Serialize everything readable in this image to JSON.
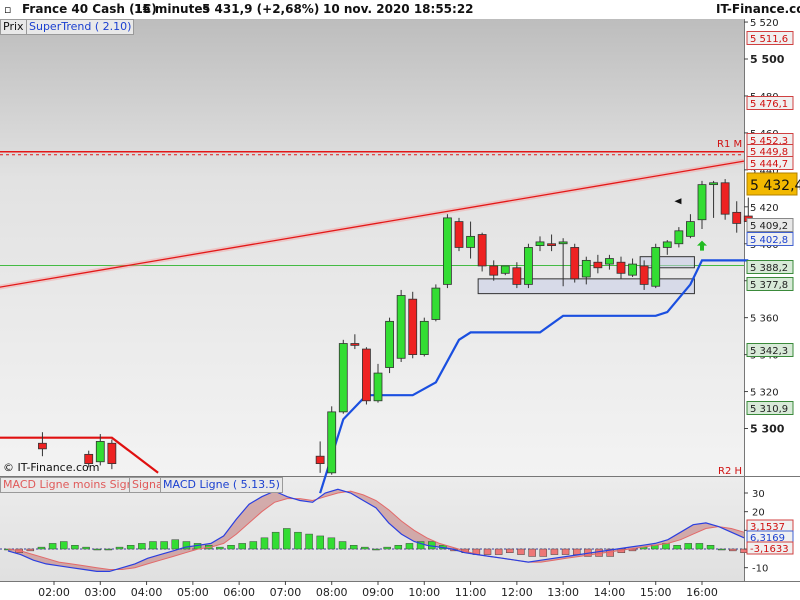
{
  "header": {
    "instrument": "France 40 Cash (1€)",
    "timeframe": "15 minutes",
    "last_change": "5 431,9 (+2,68%)",
    "datetime": "10 nov. 2020 18:55:22",
    "brand": "IT-Finance.com"
  },
  "indicators": {
    "prix": "Prix",
    "supertrend": "SuperTrend ( 2.10)"
  },
  "macd_legend": {
    "histogram": "MACD Ligne moins Signal",
    "signal": "Signal",
    "line": "MACD Ligne ( 5.13.5)"
  },
  "watermark": "© IT-Finance.com",
  "level_labels": {
    "r1m": "R1 M",
    "r2h": "R2 H"
  },
  "price_axis": {
    "ticks": [
      "5 520",
      "5 500",
      "5 480",
      "5 460",
      "5 440",
      "5 420",
      "5 400",
      "5 380",
      "5 360",
      "5 340",
      "5 320",
      "5 300"
    ],
    "major": [
      "5 500",
      "5 300"
    ]
  },
  "price_tags": [
    {
      "label": "5 511,6",
      "kind": "red"
    },
    {
      "label": "5 476,1",
      "kind": "red"
    },
    {
      "label": "5 452,3",
      "kind": "red"
    },
    {
      "label": "5 449,8",
      "kind": "red"
    },
    {
      "label": "5 444,7",
      "kind": "red"
    },
    {
      "label": "5 432,4",
      "kind": "last"
    },
    {
      "label": "5 409,2",
      "kind": "grey"
    },
    {
      "label": "5 402,8",
      "kind": "blue"
    },
    {
      "label": "5 388,2",
      "kind": "green"
    },
    {
      "label": "5 377,8",
      "kind": "green"
    },
    {
      "label": "5 342,3",
      "kind": "green"
    },
    {
      "label": "5 310,9",
      "kind": "green"
    }
  ],
  "macd_axis": {
    "ticks": [
      "30",
      "20",
      "10",
      "0",
      "-10"
    ]
  },
  "macd_tags": [
    {
      "label": "3,1537",
      "kind": "red"
    },
    {
      "label": "6,3169",
      "kind": "blue"
    },
    {
      "label": "-3,1633",
      "kind": "red"
    }
  ],
  "time_axis": {
    "ticks": [
      "02:00",
      "03:00",
      "04:00",
      "05:00",
      "06:00",
      "07:00",
      "08:00",
      "09:00",
      "10:00",
      "11:00",
      "12:00",
      "13:00",
      "14:00",
      "15:00",
      "16:00"
    ]
  },
  "colors": {
    "up": "#33dd33",
    "down": "#ee2222",
    "supertrend_up": "#1a4fe0",
    "supertrend_down": "#e01010",
    "trendline": "#e31818",
    "support_line": "#44bb44",
    "resistance": "#e31818",
    "macd_line": "#2a3fe0",
    "signal_line": "#e36a6a"
  },
  "chart_data": {
    "type": "candlestick",
    "title": "France 40 Cash (1€)",
    "timeframe": "15 minutes",
    "ylim": [
      5290,
      5523
    ],
    "candles": [
      {
        "t": "01:45",
        "o": 5292,
        "h": 5298,
        "l": 5285,
        "c": 5289
      },
      {
        "t": "02:45",
        "o": 5286,
        "h": 5288,
        "l": 5279,
        "c": 5281
      },
      {
        "t": "03:00",
        "o": 5282,
        "h": 5297,
        "l": 5280,
        "c": 5293
      },
      {
        "t": "03:15",
        "o": 5292,
        "h": 5294,
        "l": 5278,
        "c": 5281
      },
      {
        "t": "07:45",
        "o": 5285,
        "h": 5293,
        "l": 5276,
        "c": 5281
      },
      {
        "t": "08:00",
        "o": 5276,
        "h": 5312,
        "l": 5275,
        "c": 5309
      },
      {
        "t": "08:15",
        "o": 5309,
        "h": 5348,
        "l": 5308,
        "c": 5346
      },
      {
        "t": "08:30",
        "o": 5346,
        "h": 5351,
        "l": 5343,
        "c": 5345
      },
      {
        "t": "08:45",
        "o": 5343,
        "h": 5344,
        "l": 5313,
        "c": 5315
      },
      {
        "t": "09:00",
        "o": 5315,
        "h": 5335,
        "l": 5314,
        "c": 5330
      },
      {
        "t": "09:15",
        "o": 5333,
        "h": 5360,
        "l": 5330,
        "c": 5358
      },
      {
        "t": "09:30",
        "o": 5338,
        "h": 5375,
        "l": 5336,
        "c": 5372
      },
      {
        "t": "09:45",
        "o": 5370,
        "h": 5374,
        "l": 5338,
        "c": 5340
      },
      {
        "t": "10:00",
        "o": 5340,
        "h": 5360,
        "l": 5339,
        "c": 5358
      },
      {
        "t": "10:15",
        "o": 5359,
        "h": 5378,
        "l": 5358,
        "c": 5376
      },
      {
        "t": "10:30",
        "o": 5378,
        "h": 5416,
        "l": 5376,
        "c": 5414
      },
      {
        "t": "10:45",
        "o": 5412,
        "h": 5414,
        "l": 5396,
        "c": 5398
      },
      {
        "t": "11:00",
        "o": 5398,
        "h": 5412,
        "l": 5392,
        "c": 5404
      },
      {
        "t": "11:15",
        "o": 5405,
        "h": 5406,
        "l": 5385,
        "c": 5388
      },
      {
        "t": "11:30",
        "o": 5388,
        "h": 5391,
        "l": 5380,
        "c": 5383
      },
      {
        "t": "11:45",
        "o": 5384,
        "h": 5388,
        "l": 5383,
        "c": 5388
      },
      {
        "t": "12:00",
        "o": 5387,
        "h": 5390,
        "l": 5376,
        "c": 5378
      },
      {
        "t": "12:15",
        "o": 5378,
        "h": 5400,
        "l": 5376,
        "c": 5398
      },
      {
        "t": "12:30",
        "o": 5399,
        "h": 5404,
        "l": 5396,
        "c": 5401
      },
      {
        "t": "12:45",
        "o": 5400,
        "h": 5405,
        "l": 5396,
        "c": 5399
      },
      {
        "t": "13:00",
        "o": 5400,
        "h": 5403,
        "l": 5377,
        "c": 5401
      },
      {
        "t": "13:15",
        "o": 5398,
        "h": 5400,
        "l": 5379,
        "c": 5381
      },
      {
        "t": "13:30",
        "o": 5382,
        "h": 5393,
        "l": 5378,
        "c": 5391
      },
      {
        "t": "13:45",
        "o": 5390,
        "h": 5394,
        "l": 5384,
        "c": 5387
      },
      {
        "t": "14:00",
        "o": 5389,
        "h": 5394,
        "l": 5386,
        "c": 5392
      },
      {
        "t": "14:15",
        "o": 5390,
        "h": 5393,
        "l": 5381,
        "c": 5384
      },
      {
        "t": "14:30",
        "o": 5383,
        "h": 5392,
        "l": 5382,
        "c": 5389
      },
      {
        "t": "14:45",
        "o": 5388,
        "h": 5391,
        "l": 5375,
        "c": 5378
      },
      {
        "t": "15:00",
        "o": 5377,
        "h": 5400,
        "l": 5376,
        "c": 5398
      },
      {
        "t": "15:15",
        "o": 5398,
        "h": 5402,
        "l": 5394,
        "c": 5401
      },
      {
        "t": "15:30",
        "o": 5400,
        "h": 5409,
        "l": 5398,
        "c": 5407
      },
      {
        "t": "15:45",
        "o": 5404,
        "h": 5416,
        "l": 5403,
        "c": 5412
      },
      {
        "t": "16:00",
        "o": 5413,
        "h": 5434,
        "l": 5408,
        "c": 5432
      },
      {
        "t": "16:15",
        "o": 5432,
        "h": 5434,
        "l": 5414,
        "c": 5433
      },
      {
        "t": "16:30",
        "o": 5433,
        "h": 5435,
        "l": 5413,
        "c": 5416
      },
      {
        "t": "16:45",
        "o": 5417,
        "h": 5423,
        "l": 5406,
        "c": 5411
      },
      {
        "t": "17:00",
        "o": 5415,
        "h": 5425,
        "l": 5411,
        "c": 5412
      }
    ],
    "supertrend": {
      "down_segment": [
        [
          "00:00",
          5319
        ],
        [
          "00:15",
          5319
        ],
        [
          "00:45",
          5295
        ],
        [
          "03:15",
          5295
        ],
        [
          "04:15",
          5276
        ]
      ],
      "up_segment": [
        [
          "07:45",
          5265
        ],
        [
          "08:15",
          5305
        ],
        [
          "08:45",
          5318
        ],
        [
          "09:45",
          5318
        ],
        [
          "10:15",
          5325
        ],
        [
          "10:45",
          5348
        ],
        [
          "11:00",
          5352
        ],
        [
          "12:30",
          5352
        ],
        [
          "13:00",
          5361
        ],
        [
          "15:00",
          5361
        ],
        [
          "15:15",
          5363
        ],
        [
          "15:45",
          5378
        ],
        [
          "16:00",
          5391
        ],
        [
          "17:00",
          5391
        ]
      ]
    },
    "trendline": [
      [
        "00:00",
        5373
      ],
      [
        "17:00",
        5444.7
      ]
    ],
    "horizontal_levels": [
      {
        "label": "R1 M",
        "value": 5449.8
      },
      {
        "value": 5388.2
      }
    ],
    "boxes": [
      {
        "from": "11:15",
        "to": "15:45",
        "low": 5373,
        "high": 5381
      },
      {
        "from": "14:45",
        "to": "15:45",
        "low": 5387,
        "high": 5393
      }
    ],
    "macd": {
      "ylim": [
        -16,
        37
      ],
      "histogram": [
        0,
        -2,
        -1,
        1,
        3,
        4,
        2,
        1,
        0,
        0,
        1,
        2,
        3,
        4,
        4,
        5,
        4,
        3,
        2,
        1,
        2,
        3,
        4,
        6,
        9,
        11,
        9,
        8,
        7,
        6,
        4,
        2,
        1,
        0,
        1,
        2,
        3,
        4,
        4,
        2,
        -1,
        -2,
        -3,
        -3,
        -3,
        -2,
        -3,
        -4,
        -4,
        -3,
        -3,
        -3,
        -4,
        -4,
        -4,
        -2,
        -1,
        1,
        2,
        3,
        2,
        3,
        3,
        2,
        0,
        -1,
        -2
      ],
      "line": [
        -1,
        -3,
        -6,
        -8,
        -9,
        -10,
        -11,
        -12,
        -12,
        -10,
        -8,
        -5,
        -3,
        -1,
        1,
        2,
        3,
        7,
        16,
        24,
        28,
        31,
        28,
        26,
        25,
        30,
        32,
        30,
        26,
        22,
        14,
        8,
        4,
        2,
        1,
        0,
        -2,
        -3,
        -4,
        -5,
        -6,
        -7,
        -6,
        -5,
        -4,
        -3,
        -2,
        -1,
        0,
        1,
        2,
        3,
        5,
        9,
        13,
        14,
        12,
        9,
        6
      ],
      "signal": [
        0,
        -1,
        -3,
        -5,
        -7,
        -8,
        -9,
        -10,
        -11,
        -11,
        -10,
        -8,
        -6,
        -4,
        -2,
        0,
        1,
        3,
        8,
        14,
        20,
        25,
        27,
        27,
        26,
        28,
        30,
        31,
        29,
        26,
        21,
        15,
        10,
        6,
        3,
        1,
        -1,
        -3,
        -4,
        -5,
        -6,
        -7,
        -7,
        -6,
        -5,
        -4,
        -3,
        -2,
        -1,
        0,
        1,
        2,
        3,
        5,
        8,
        11,
        12,
        11,
        9
      ]
    }
  }
}
